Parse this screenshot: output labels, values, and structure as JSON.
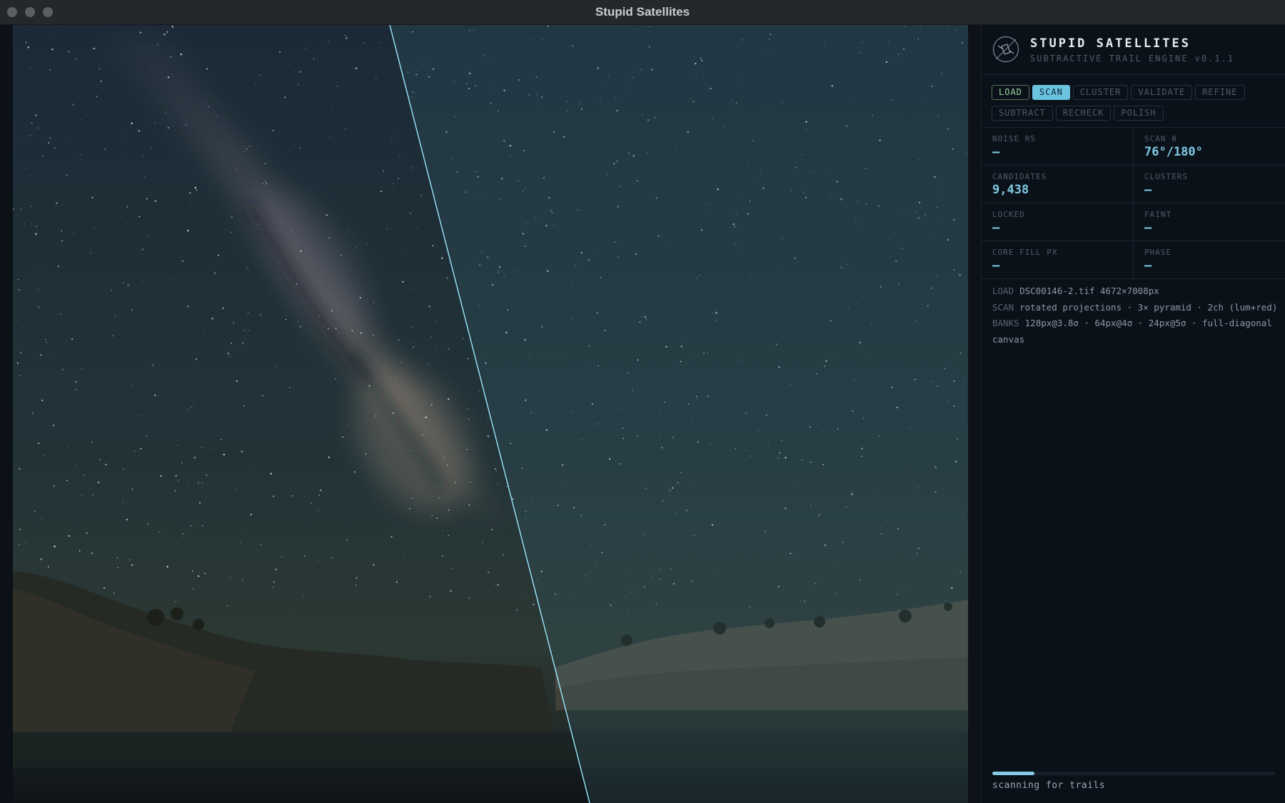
{
  "window": {
    "title": "Stupid Satellites"
  },
  "brand": {
    "name": "STUPID SATELLITES",
    "subtitle": "SUBTRACTIVE TRAIL ENGINE v0.1.1"
  },
  "stages": [
    {
      "label": "LOAD",
      "state": "done"
    },
    {
      "label": "SCAN",
      "state": "active"
    },
    {
      "label": "CLUSTER",
      "state": "pending"
    },
    {
      "label": "VALIDATE",
      "state": "pending"
    },
    {
      "label": "REFINE",
      "state": "pending"
    },
    {
      "label": "SUBTRACT",
      "state": "pending"
    },
    {
      "label": "RECHECK",
      "state": "pending"
    },
    {
      "label": "POLISH",
      "state": "pending"
    }
  ],
  "stats": {
    "noise_rs": {
      "label": "NOISE RS",
      "value": "—"
    },
    "scan_theta": {
      "label": "SCAN θ",
      "value": "76°/180°"
    },
    "candidates": {
      "label": "CANDIDATES",
      "value": "9,438"
    },
    "clusters": {
      "label": "CLUSTERS",
      "value": "—"
    },
    "locked": {
      "label": "LOCKED",
      "value": "—"
    },
    "faint": {
      "label": "FAINT",
      "value": "—"
    },
    "core_fill_px": {
      "label": "CORE FILL PX",
      "value": "—"
    },
    "phase": {
      "label": "PHASE",
      "value": "—"
    }
  },
  "log": [
    {
      "key": "LOAD",
      "text": "DSC00146-2.tif 4672×7008px"
    },
    {
      "key": "SCAN",
      "text": "rotated projections · 3× pyramid · 2ch (lum+red)"
    },
    {
      "key": "BANKS",
      "text": "128px@3.8σ · 64px@4σ · 24px@5σ · full-diagonal canvas"
    }
  ],
  "progress": {
    "fraction": 0.15,
    "status": "scanning for trails"
  },
  "colors": {
    "accent": "#6ac3df",
    "done": "#9fd69f",
    "scan_line": "#8fd8ee"
  }
}
